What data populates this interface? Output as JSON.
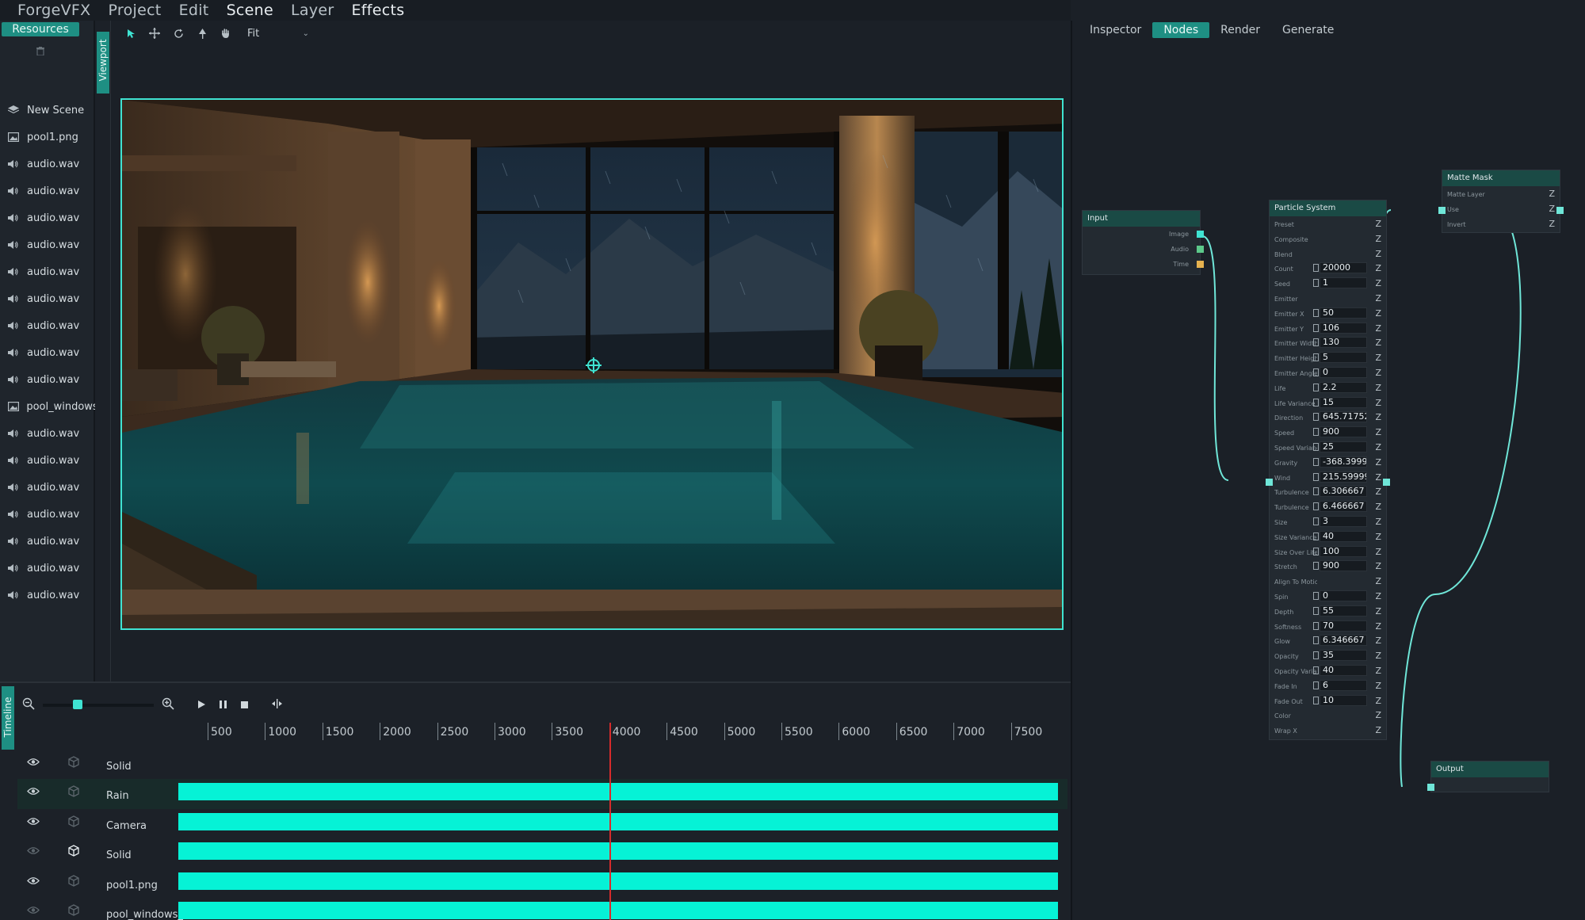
{
  "app": {
    "menus": [
      "ForgeVFX",
      "Project",
      "Edit",
      "Scene",
      "Layer",
      "Effects"
    ]
  },
  "resources": {
    "tab_label": "Resources",
    "items": [
      {
        "label": "New Scene",
        "icon": "scene-icon"
      },
      {
        "label": "pool1.png",
        "icon": "image-icon"
      },
      {
        "label": "audio.wav",
        "icon": "speaker-icon"
      },
      {
        "label": "audio.wav",
        "icon": "speaker-icon"
      },
      {
        "label": "audio.wav",
        "icon": "speaker-icon"
      },
      {
        "label": "audio.wav",
        "icon": "speaker-icon"
      },
      {
        "label": "audio.wav",
        "icon": "speaker-icon"
      },
      {
        "label": "audio.wav",
        "icon": "speaker-icon"
      },
      {
        "label": "audio.wav",
        "icon": "speaker-icon"
      },
      {
        "label": "audio.wav",
        "icon": "speaker-icon"
      },
      {
        "label": "audio.wav",
        "icon": "speaker-icon"
      },
      {
        "label": "pool_windows",
        "icon": "image-icon"
      },
      {
        "label": "audio.wav",
        "icon": "speaker-icon"
      },
      {
        "label": "audio.wav",
        "icon": "speaker-icon"
      },
      {
        "label": "audio.wav",
        "icon": "speaker-icon"
      },
      {
        "label": "audio.wav",
        "icon": "speaker-icon"
      },
      {
        "label": "audio.wav",
        "icon": "speaker-icon"
      },
      {
        "label": "audio.wav",
        "icon": "speaker-icon"
      },
      {
        "label": "audio.wav",
        "icon": "speaker-icon"
      }
    ]
  },
  "viewport": {
    "tab_label": "Viewport",
    "tools": [
      "select-arrow-icon",
      "move-icon",
      "rotate-icon",
      "pin-icon",
      "hand-icon"
    ],
    "zoom_mode": "Fit"
  },
  "right_panel": {
    "tabs": [
      "Inspector",
      "Nodes",
      "Render",
      "Generate"
    ],
    "active_tab": "Nodes"
  },
  "nodes": {
    "input": {
      "title": "Input",
      "ports": [
        {
          "label": "Image",
          "color": "#3fe3d2"
        },
        {
          "label": "Audio",
          "color": "#5cc98a"
        },
        {
          "label": "Time",
          "color": "#e6b24f"
        }
      ]
    },
    "particle": {
      "title": "Particle System",
      "params": [
        {
          "label": "Preset",
          "value": null
        },
        {
          "label": "Composite",
          "value": null
        },
        {
          "label": "Blend",
          "value": null
        },
        {
          "label": "Count",
          "value": "20000"
        },
        {
          "label": "Seed",
          "value": "1"
        },
        {
          "label": "Emitter",
          "value": null
        },
        {
          "label": "Emitter X",
          "value": "50"
        },
        {
          "label": "Emitter Y",
          "value": "106"
        },
        {
          "label": "Emitter Width",
          "value": "130"
        },
        {
          "label": "Emitter Height",
          "value": "5"
        },
        {
          "label": "Emitter Angle",
          "value": "0"
        },
        {
          "label": "Life",
          "value": "2.2"
        },
        {
          "label": "Life Variance",
          "value": "15"
        },
        {
          "label": "Direction",
          "value": "645.71752"
        },
        {
          "label": "Speed",
          "value": "900"
        },
        {
          "label": "Speed Variance",
          "value": "25"
        },
        {
          "label": "Gravity",
          "value": "-368.3999"
        },
        {
          "label": "Wind",
          "value": "215.59999"
        },
        {
          "label": "Turbulence",
          "value": "6.306667"
        },
        {
          "label": "Turbulence",
          "value": "6.466667"
        },
        {
          "label": "Size",
          "value": "3"
        },
        {
          "label": "Size Variance",
          "value": "40"
        },
        {
          "label": "Size Over Life",
          "value": "100"
        },
        {
          "label": "Stretch",
          "value": "900"
        },
        {
          "label": "Align To Motion",
          "value": null
        },
        {
          "label": "Spin",
          "value": "0"
        },
        {
          "label": "Depth",
          "value": "55"
        },
        {
          "label": "Softness",
          "value": "70"
        },
        {
          "label": "Glow",
          "value": "6.346667"
        },
        {
          "label": "Opacity",
          "value": "35"
        },
        {
          "label": "Opacity Variance",
          "value": "40"
        },
        {
          "label": "Fade In",
          "value": "6"
        },
        {
          "label": "Fade Out",
          "value": "10"
        },
        {
          "label": "Color",
          "value": null
        },
        {
          "label": "Wrap X",
          "value": null
        }
      ]
    },
    "matte": {
      "title": "Matte Mask",
      "params": [
        "Matte Layer",
        "Use",
        "Invert"
      ]
    },
    "output": {
      "title": "Output"
    }
  },
  "timeline": {
    "tab_label": "Timeline",
    "zoom_level": 0.3,
    "ruler": [
      "500",
      "1000",
      "1500",
      "2000",
      "2500",
      "3000",
      "3500",
      "4000",
      "4500",
      "5000",
      "5500",
      "6000",
      "6500",
      "7000",
      "7500"
    ],
    "playhead_frame": 4000,
    "tracks": [
      {
        "name": "Solid",
        "visible": true,
        "is3d": false,
        "has_clip": false,
        "selected": false
      },
      {
        "name": "Rain",
        "visible": true,
        "is3d": false,
        "has_clip": true,
        "selected": true
      },
      {
        "name": "Camera",
        "visible": true,
        "is3d": false,
        "has_clip": true,
        "selected": false
      },
      {
        "name": "Solid",
        "visible": false,
        "is3d": true,
        "has_clip": true,
        "selected": false
      },
      {
        "name": "pool1.png",
        "visible": true,
        "is3d": false,
        "has_clip": true,
        "selected": false
      },
      {
        "name": "pool_windows_",
        "visible": false,
        "is3d": false,
        "has_clip": true,
        "selected": false
      }
    ],
    "clip_color": "#06f2d6"
  }
}
